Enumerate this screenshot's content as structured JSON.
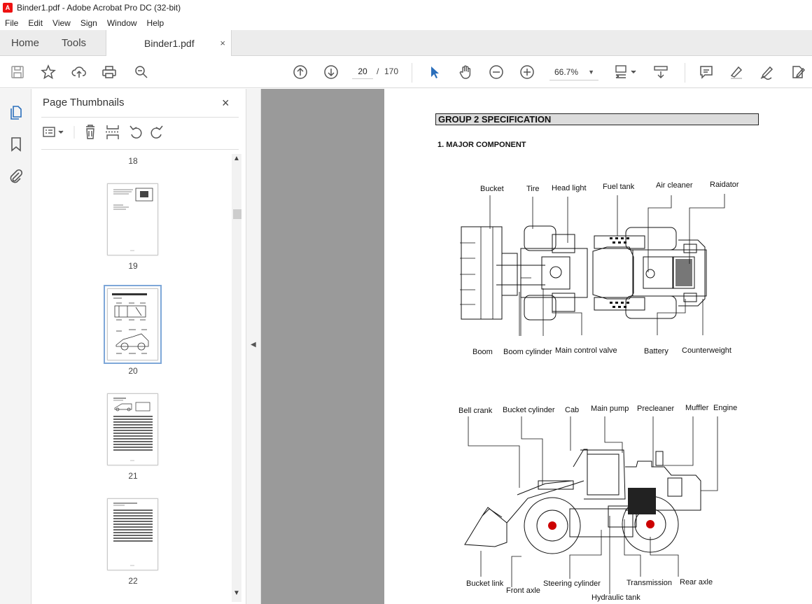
{
  "window": {
    "title": "Binder1.pdf - Adobe Acrobat Pro DC (32-bit)",
    "app_icon_text": "A"
  },
  "menubar": {
    "items": [
      "File",
      "Edit",
      "View",
      "Sign",
      "Window",
      "Help"
    ]
  },
  "tabs": {
    "home": "Home",
    "tools": "Tools",
    "document": "Binder1.pdf",
    "close": "×"
  },
  "toolbar": {
    "current_page": "20",
    "page_separator": "/",
    "total_pages": "170",
    "zoom": "66.7%"
  },
  "sidebar": {
    "title": "Page Thumbnails",
    "close": "×",
    "thumbnails": [
      {
        "page": "18"
      },
      {
        "page": "19"
      },
      {
        "page": "20",
        "selected": true
      },
      {
        "page": "21"
      },
      {
        "page": "22"
      }
    ]
  },
  "document": {
    "group_title": "GROUP  2  SPECIFICATION",
    "section_title": "1. MAJOR COMPONENT",
    "top_view_labels": {
      "bucket": "Bucket",
      "tire": "Tire",
      "head_light": "Head light",
      "fuel_tank": "Fuel tank",
      "air_cleaner": "Air cleaner",
      "radiator": "Raidator",
      "boom": "Boom",
      "boom_cylinder": "Boom cylinder",
      "main_control_valve": "Main control valve",
      "battery": "Battery",
      "counterweight": "Counterweight"
    },
    "side_view_labels": {
      "bell_crank": "Bell crank",
      "bucket_cylinder": "Bucket cylinder",
      "cab": "Cab",
      "main_pump": "Main pump",
      "precleaner": "Precleaner",
      "muffler": "Muffler",
      "engine": "Engine",
      "bucket_link": "Bucket link",
      "front_axle": "Front axle",
      "steering_cylinder": "Steering cylinder",
      "transmission": "Transmission",
      "rear_axle": "Rear axle",
      "hydraulic_tank": "Hydraulic tank"
    }
  }
}
